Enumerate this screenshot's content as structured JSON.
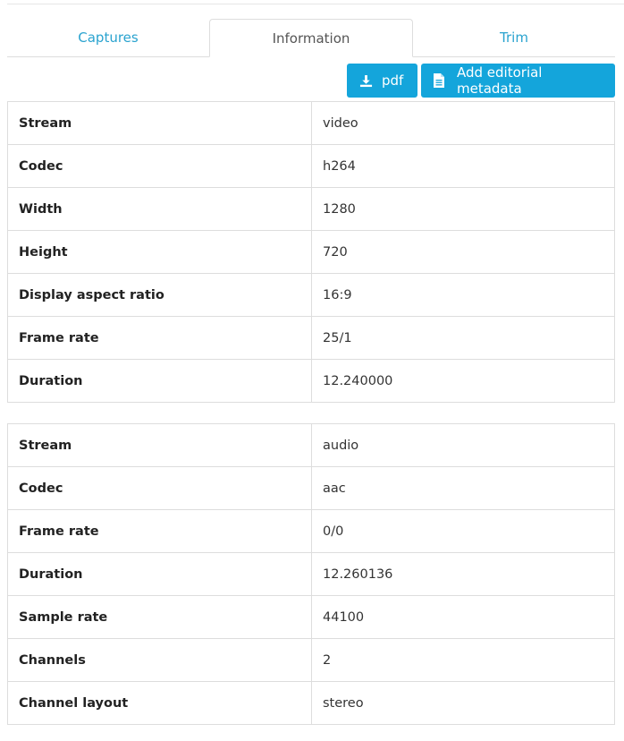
{
  "tabs": [
    {
      "label": "Captures",
      "active": false
    },
    {
      "label": "Information",
      "active": true
    },
    {
      "label": "Trim",
      "active": false
    }
  ],
  "toolbar": {
    "pdf_label": "pdf",
    "pdf_icon": "download-icon",
    "metadata_label": "Add editorial metadata",
    "metadata_icon": "document-icon"
  },
  "video_stream": {
    "rows": [
      {
        "key": "Stream",
        "value": "video"
      },
      {
        "key": "Codec",
        "value": "h264"
      },
      {
        "key": "Width",
        "value": "1280"
      },
      {
        "key": "Height",
        "value": "720"
      },
      {
        "key": "Display aspect ratio",
        "value": "16:9"
      },
      {
        "key": "Frame rate",
        "value": "25/1"
      },
      {
        "key": "Duration",
        "value": "12.240000"
      }
    ]
  },
  "audio_stream": {
    "rows": [
      {
        "key": "Stream",
        "value": "audio"
      },
      {
        "key": "Codec",
        "value": "aac"
      },
      {
        "key": "Frame rate",
        "value": "0/0"
      },
      {
        "key": "Duration",
        "value": "12.260136"
      },
      {
        "key": "Sample rate",
        "value": "44100"
      },
      {
        "key": "Channels",
        "value": "2"
      },
      {
        "key": "Channel layout",
        "value": "stereo"
      }
    ]
  },
  "colors": {
    "accent": "#14a5db",
    "tab_link": "#2aa3cf",
    "border": "#dddddd"
  }
}
